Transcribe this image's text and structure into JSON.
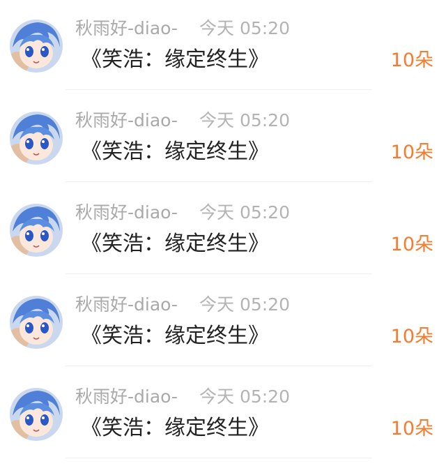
{
  "items": [
    {
      "user": "秋雨好-diao-",
      "time": "今天 05:20",
      "title": "《笑浩：缘定终生》",
      "gift": "10朵",
      "avatar_icon": "anime-girl-avatar"
    },
    {
      "user": "秋雨好-diao-",
      "time": "今天 05:20",
      "title": "《笑浩：缘定终生》",
      "gift": "10朵",
      "avatar_icon": "anime-girl-avatar"
    },
    {
      "user": "秋雨好-diao-",
      "time": "今天 05:20",
      "title": "《笑浩：缘定终生》",
      "gift": "10朵",
      "avatar_icon": "anime-girl-avatar"
    },
    {
      "user": "秋雨好-diao-",
      "time": "今天 05:20",
      "title": "《笑浩：缘定终生》",
      "gift": "10朵",
      "avatar_icon": "anime-girl-avatar"
    },
    {
      "user": "秋雨好-diao-",
      "time": "今天 05:20",
      "title": "《笑浩：缘定终生》",
      "gift": "10朵",
      "avatar_icon": "anime-girl-avatar"
    }
  ],
  "colors": {
    "username": "#a9a9a9",
    "timestamp": "#b3b3b3",
    "title": "#222222",
    "gift": "#f57c2f",
    "divider": "#eeeeee"
  }
}
